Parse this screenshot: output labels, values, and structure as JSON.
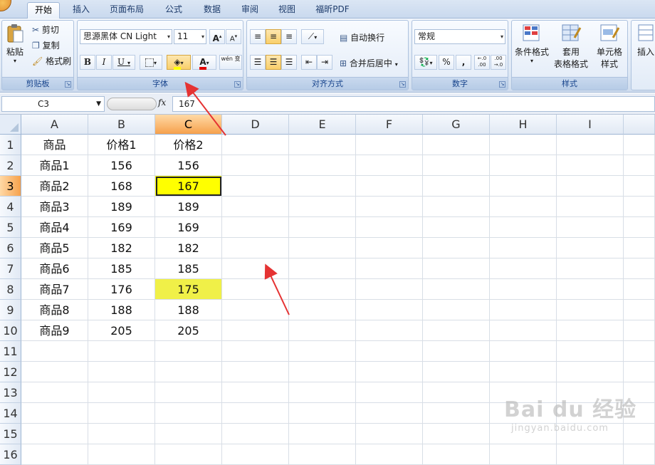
{
  "tabs": [
    "开始",
    "插入",
    "页面布局",
    "公式",
    "数据",
    "审阅",
    "视图",
    "福昕PDF"
  ],
  "active_tab": 0,
  "ribbon": {
    "clipboard": {
      "paste": "粘贴",
      "cut": "剪切",
      "copy": "复制",
      "format_painter": "格式刷",
      "label": "剪贴板"
    },
    "font": {
      "font_name": "思源黑体 CN Light",
      "font_size": "11",
      "grow": "A",
      "shrink": "A",
      "bold": "B",
      "italic": "I",
      "underline": "U",
      "font_color": "A",
      "phonetic": "wén 变",
      "label": "字体"
    },
    "alignment": {
      "wrap_text": "自动换行",
      "merge_center": "合并后居中",
      "label": "对齐方式"
    },
    "number": {
      "format": "常规",
      "percent": "%",
      "comma": ",",
      "inc_decimal": "←.0 .00",
      "dec_decimal": ".00 →.0",
      "label": "数字"
    },
    "styles": {
      "conditional": "条件格式",
      "table_fmt_1": "套用",
      "table_fmt_2": "表格格式",
      "cell_styles_1": "单元格",
      "cell_styles_2": "样式",
      "label": "样式"
    },
    "cells": {
      "insert": "插入"
    }
  },
  "formula_bar": {
    "name_box": "C3",
    "fx": "fx",
    "formula": "167"
  },
  "columns": [
    "A",
    "B",
    "C",
    "D",
    "E",
    "F",
    "G",
    "H",
    "I"
  ],
  "selected_column": "C",
  "rows": [
    [
      "商品",
      "价格1",
      "价格2"
    ],
    [
      "商品1",
      "156",
      "156"
    ],
    [
      "商品2",
      "168",
      "167"
    ],
    [
      "商品3",
      "189",
      "189"
    ],
    [
      "商品4",
      "169",
      "169"
    ],
    [
      "商品5",
      "182",
      "182"
    ],
    [
      "商品6",
      "185",
      "185"
    ],
    [
      "商品7",
      "176",
      "175"
    ],
    [
      "商品8",
      "188",
      "188"
    ],
    [
      "商品9",
      "205",
      "205"
    ],
    [
      "",
      "",
      ""
    ],
    [
      "",
      "",
      ""
    ],
    [
      "",
      "",
      ""
    ],
    [
      "",
      "",
      ""
    ],
    [
      "",
      "",
      ""
    ],
    [
      "",
      "",
      ""
    ]
  ],
  "highlighted_cells": [
    {
      "row": 3,
      "col": "C",
      "color": "#ffff00"
    },
    {
      "row": 8,
      "col": "C",
      "color": "#f0f048"
    }
  ],
  "active_cell": {
    "row": 3,
    "col": "C"
  },
  "watermark": {
    "brand": "Bai du 经验",
    "url": "jingyan.baidu.com"
  },
  "colors": {
    "accent": "#f6a14c",
    "highlight": "#ffff00",
    "arrow": "#e53333",
    "ribbon": "#dfe9f5"
  }
}
